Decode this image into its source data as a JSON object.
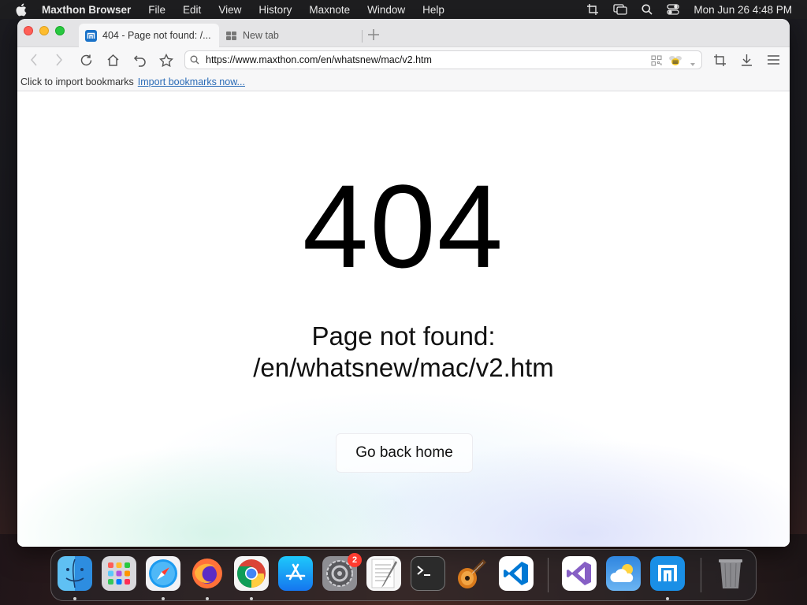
{
  "menubar": {
    "app_name": "Maxthon Browser",
    "items": [
      "File",
      "Edit",
      "View",
      "History",
      "Maxnote",
      "Window",
      "Help"
    ],
    "clock": "Mon Jun 26  4:48 PM"
  },
  "browser": {
    "tabs": [
      {
        "title": "404 - Page not found: /...",
        "active": true
      },
      {
        "title": "New tab",
        "active": false
      }
    ],
    "url": "https://www.maxthon.com/en/whatsnew/mac/v2.htm",
    "bookmarks_bar": {
      "prompt": "Click to import bookmarks",
      "link": "Import bookmarks now..."
    }
  },
  "page": {
    "error_code": "404",
    "message_line1": "Page not found:",
    "message_line2": "/en/whatsnew/mac/v2.htm",
    "home_button": "Go back home"
  },
  "dock": {
    "items": [
      "Finder",
      "Launchpad",
      "Safari",
      "Firefox",
      "Chrome",
      "App Store",
      "System Preferences",
      "TextEdit",
      "Terminal",
      "GarageBand",
      "Visual Studio Code",
      "Visual Studio",
      "Weather",
      "Maxthon",
      "Trash"
    ],
    "system_preferences_badge": "2"
  },
  "colors": {
    "link": "#2a6bb6",
    "close": "#ff5f57",
    "minimize": "#febc2e",
    "maximize": "#28c840"
  }
}
